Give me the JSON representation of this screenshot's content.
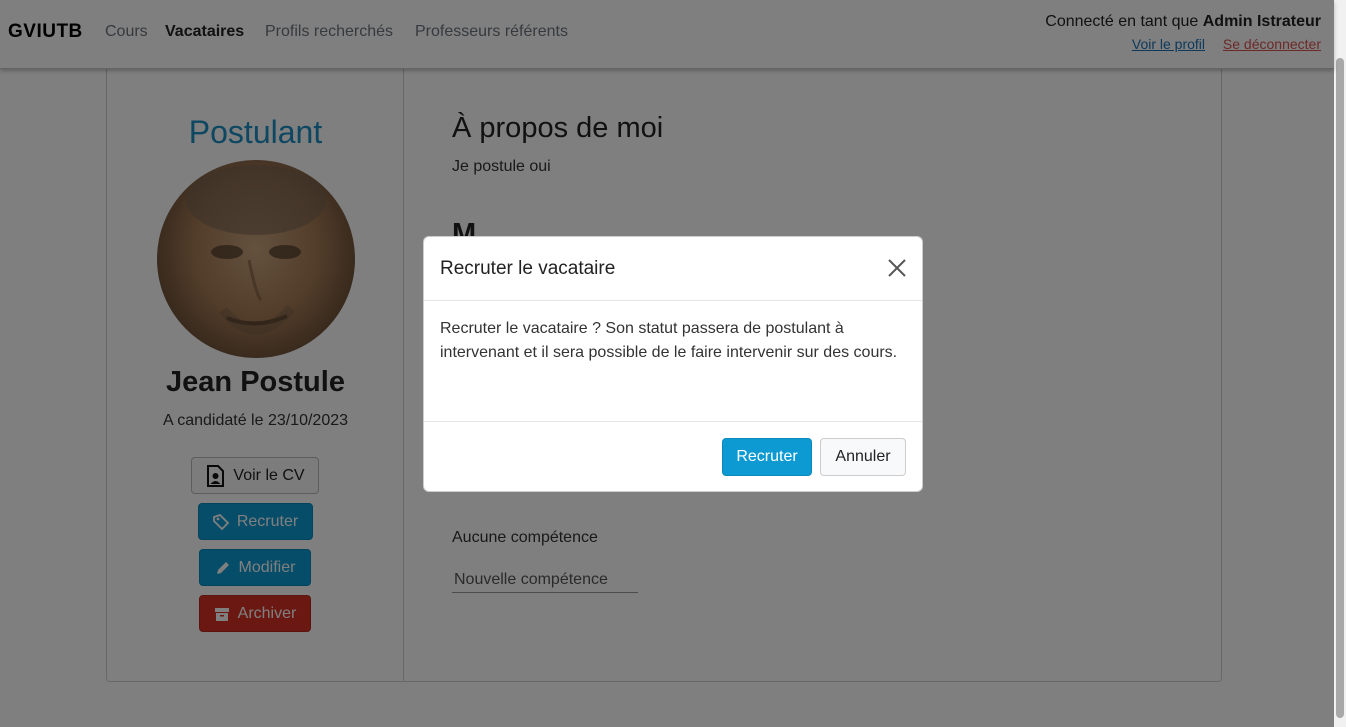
{
  "navbar": {
    "brand": "GVIUTB",
    "links": [
      "Cours",
      "Vacataires",
      "Profils recherchés",
      "Professeurs référents"
    ],
    "user_prefix": "Connecté en tant que",
    "user_name": "Admin Istrateur",
    "profile_link": "Voir le profil",
    "logout_link": "Se déconnecter"
  },
  "profile": {
    "role": "Postulant",
    "name": "Jean Postule",
    "applied": "A candidaté le 23/10/2023",
    "buttons": {
      "cv": "Voir le CV",
      "recruit": "Recruter",
      "modify": "Modifier",
      "archive": "Archiver"
    }
  },
  "about": {
    "title": "À propos de moi",
    "text": "Je postule oui"
  },
  "skills": {
    "title_partial": "M",
    "empty": "Aucune compétence",
    "new_placeholder": "Nouvelle compétence"
  },
  "modal": {
    "title": "Recruter le vacataire",
    "body": "Recruter le vacataire ? Son statut passera de postulant à intervenant et il sera possible de le faire intervenir sur des cours.",
    "confirm": "Recruter",
    "cancel": "Annuler"
  },
  "colors": {
    "primary": "#0d9ad2",
    "danger": "#d93125",
    "role_title": "#1a8fc4"
  }
}
